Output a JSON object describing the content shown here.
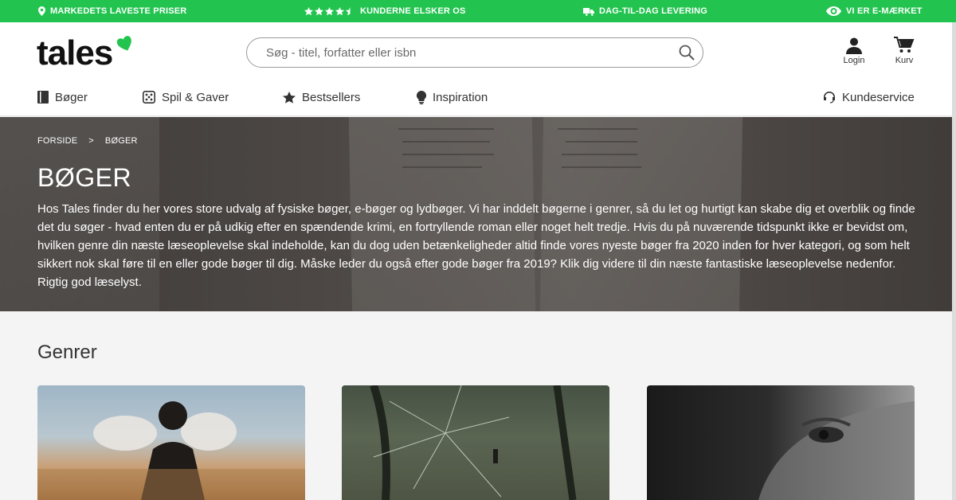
{
  "topbar": {
    "items": [
      {
        "icon": "location-pin-icon",
        "label": "MARKEDETS LAVESTE PRISER"
      },
      {
        "icon": "stars-icon",
        "label": "KUNDERNE ELSKER OS",
        "rating": 4.5
      },
      {
        "icon": "truck-icon",
        "label": "DAG-TIL-DAG LEVERING"
      },
      {
        "icon": "eye-icon",
        "label": "VI ER E-MÆRKET"
      }
    ]
  },
  "header": {
    "logo_text": "tales",
    "search_placeholder": "Søg - titel, forfatter eller isbn",
    "login_label": "Login",
    "cart_label": "Kurv"
  },
  "nav": {
    "items": [
      {
        "icon": "book-icon",
        "label": "Bøger"
      },
      {
        "icon": "dice-icon",
        "label": "Spil & Gaver"
      },
      {
        "icon": "star-icon",
        "label": "Bestsellers"
      },
      {
        "icon": "lightbulb-icon",
        "label": "Inspiration"
      }
    ],
    "service": {
      "icon": "headset-icon",
      "label": "Kundeservice"
    }
  },
  "hero": {
    "breadcrumb": [
      "FORSIDE",
      "BØGER"
    ],
    "breadcrumb_separator": ">",
    "title": "BØGER",
    "text": "Hos Tales finder du her vores store udvalg af fysiske bøger, e-bøger og lydbøger. Vi har inddelt bøgerne i genrer, så du let og hurtigt kan skabe dig et overblik og finde det du søger - hvad enten du er på udkig efter en spændende krimi, en fortryllende roman eller noget helt tredje. Hvis du på nuværende tidspunkt ikke er bevidst om, hvilken genre din næste læseoplevelse skal indeholde, kan du dog uden betænkeligheder altid finde vores nyeste bøger fra 2020 inden for hver kategori, og som helt sikkert nok skal føre til en eller gode bøger til dig. Måske leder du også efter gode bøger fra 2019? Klik dig videre til din næste fantastiske læseoplevelse nedenfor. Rigtig god læselyst."
  },
  "genres": {
    "title": "Genrer",
    "cards": [
      {
        "image": "person-dust-cloud-image"
      },
      {
        "image": "shattered-glass-forest-image"
      },
      {
        "image": "face-eye-closeup-image"
      }
    ]
  },
  "colors": {
    "brand_green": "#22c44f",
    "text_dark": "#222222"
  }
}
